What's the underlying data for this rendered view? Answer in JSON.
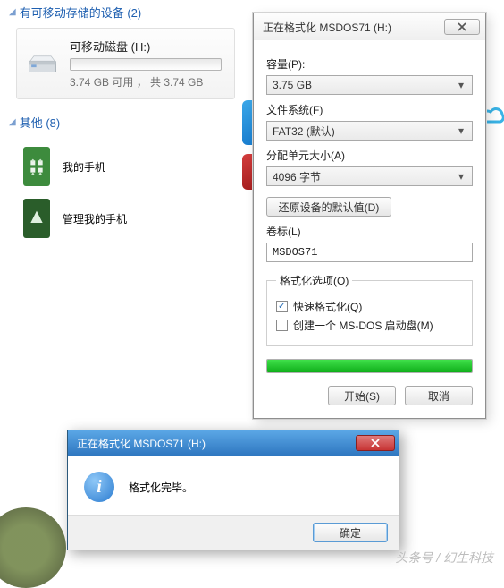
{
  "sections": {
    "removable": {
      "title": "有可移动存储的设备 (2)"
    },
    "other": {
      "title": "其他 (8)"
    }
  },
  "device": {
    "title": "可移动磁盘 (H:)",
    "subtitle": "3.74 GB 可用 ， 共 3.74 GB"
  },
  "other_items": [
    {
      "label": "我的手机"
    },
    {
      "label": "管理我的手机"
    }
  ],
  "format_dialog": {
    "title": "正在格式化 MSDOS71 (H:)",
    "capacity_label": "容量(P):",
    "capacity_value": "3.75 GB",
    "filesystem_label": "文件系统(F)",
    "filesystem_value": "FAT32 (默认)",
    "alloc_label": "分配单元大小(A)",
    "alloc_value": "4096 字节",
    "restore_btn": "还原设备的默认值(D)",
    "volume_label_label": "卷标(L)",
    "volume_label_value": "MSDOS71",
    "options_legend": "格式化选项(O)",
    "quick_format_label": "快速格式化(Q)",
    "msdos_boot_label": "创建一个 MS-DOS 启动盘(M)",
    "start_btn": "开始(S)",
    "cancel_btn": "取消"
  },
  "msgbox": {
    "title": "正在格式化 MSDOS71 (H:)",
    "text": "格式化完毕。",
    "ok_btn": "确定"
  },
  "credit": "头条号 / 幻生科技"
}
